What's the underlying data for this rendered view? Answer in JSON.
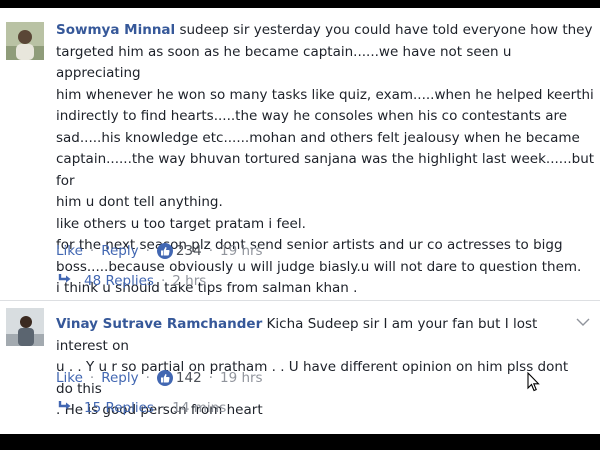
{
  "comments": [
    {
      "author": "Sowmya Minnal",
      "lines": [
        "sudeep sir yesterday you could have told everyone how they",
        "targeted him as soon as he became captain......we have not seen u appreciating",
        "him whenever he won so many tasks like quiz, exam.....when he helped keerthi",
        "indirectly to find hearts.....the way he consoles when his co contestants are",
        "sad.....his knowledge etc......mohan and others felt jealousy when he became",
        "captain......the way bhuvan tortured sanjana was the highlight last week......but for",
        "him u dont tell anything.",
        "like others u too target pratam i feel.",
        "for the next season plz dont send senior artists and ur co actresses to bigg",
        "boss.....because obviously u will judge biasly.u will not dare to question them.",
        "i think u should take tips from salman khan ."
      ],
      "like_label": "Like",
      "reply_label": "Reply",
      "reaction_count": "234",
      "time": "19 hrs",
      "replies_label": "48 Replies",
      "replies_time": "2 hrs"
    },
    {
      "author": "Vinay Sutrave Ramchander",
      "lines": [
        "Kicha Sudeep sir I am your fan but I lost interest on",
        "u . . Y u r so partial on pratham . . U have different opinion on him plss dont do this",
        ". He is good person from heart"
      ],
      "like_label": "Like",
      "reply_label": "Reply",
      "reaction_count": "142",
      "time": "19 hrs",
      "replies_label": "15 Replies",
      "replies_time": "14 mins"
    }
  ],
  "icons": {
    "reaction": "thumbs-up-icon",
    "reply_arrow": "reply-arrow-icon",
    "options": "chevron-down-icon",
    "cursor": "mouse-cursor-icon"
  },
  "colors": {
    "author": "#365899",
    "link": "#4267b2",
    "text": "#1d2129",
    "meta": "#90949c"
  }
}
